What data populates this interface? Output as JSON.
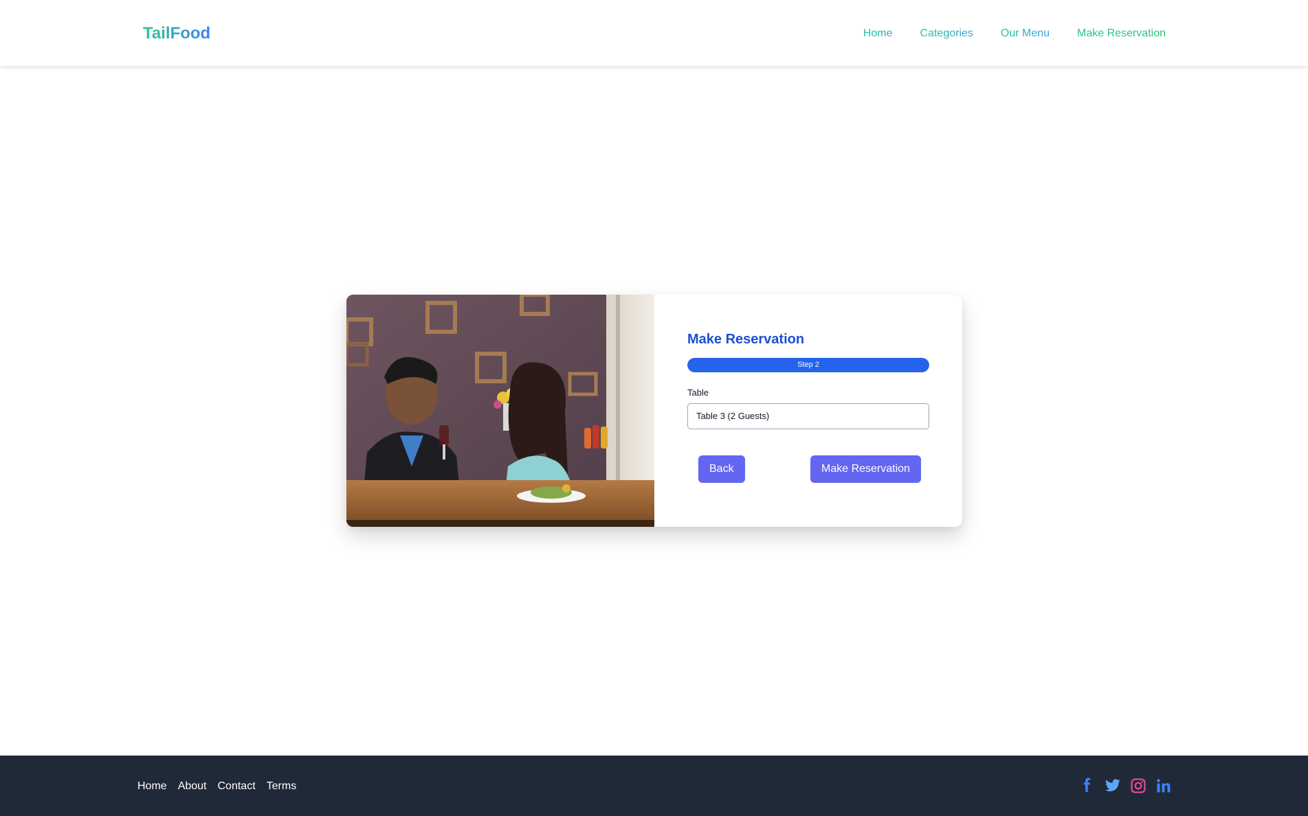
{
  "header": {
    "logo": "TailFood",
    "nav": [
      "Home",
      "Categories",
      "Our Menu",
      "Make Reservation"
    ]
  },
  "reservation": {
    "title": "Make Reservation",
    "progress": {
      "label": "Step 2",
      "fraction": 1.0
    },
    "table_label": "Table",
    "table_value": "Table 3 (2 Guests)",
    "back_label": "Back",
    "submit_label": "Make Reservation"
  },
  "footer": {
    "links": [
      "Home",
      "About",
      "Contact",
      "Terms"
    ],
    "social": [
      "facebook-icon",
      "twitter-icon",
      "instagram-icon",
      "linkedin-icon"
    ]
  },
  "colors": {
    "primary": "#2563eb",
    "button": "#6366f1",
    "footer": "#1f2937",
    "brand_green": "#34c78a",
    "brand_blue": "#3b82f6"
  }
}
